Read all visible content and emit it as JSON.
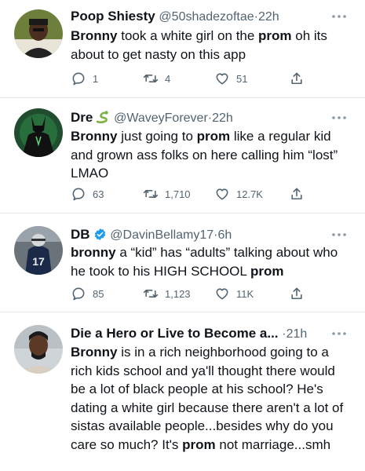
{
  "tweets": [
    {
      "name": "Poop Shiesty",
      "handle": "@50shadezoftae",
      "separator": "·",
      "time": "22h",
      "text": [
        {
          "t": "Bronny",
          "b": true
        },
        {
          "t": " took a white girl on the ",
          "b": false
        },
        {
          "t": "prom",
          "b": true
        },
        {
          "t": " oh its about to get nasty on this app",
          "b": false
        }
      ],
      "replies": "1",
      "retweets": "4",
      "likes": "51"
    },
    {
      "name": "Dre",
      "name_emoji": "snake-icon",
      "handle": "@WaveyForever",
      "separator": "·",
      "time": "22h",
      "text": [
        {
          "t": "Bronny",
          "b": true
        },
        {
          "t": " just going to ",
          "b": false
        },
        {
          "t": "prom",
          "b": true
        },
        {
          "t": " like a regular kid and grown ass folks on here calling him “lost” LMAO",
          "b": false
        }
      ],
      "replies": "63",
      "retweets": "1,710",
      "likes": "12.7K"
    },
    {
      "name": "DB",
      "verified": true,
      "handle": "@DavinBellamy17",
      "separator": "·",
      "time": "6h",
      "text": [
        {
          "t": "bronny",
          "b": true
        },
        {
          "t": " a “kid” has “adults” talking about who he took to his HIGH SCHOOL ",
          "b": false
        },
        {
          "t": "prom",
          "b": true
        }
      ],
      "replies": "85",
      "retweets": "1,123",
      "likes": "11K"
    },
    {
      "name": "Die a Hero or Live to Become a...",
      "handle": "",
      "separator": "·",
      "time": "21h",
      "text": [
        {
          "t": "Bronny",
          "b": true
        },
        {
          "t": " is in a rich neighborhood going to a rich kids school and ya'll thought there would be a lot of black people at his school? He's dating a white girl because there aren't a lot of sistas available people...besides why do you care so much? It's ",
          "b": false
        },
        {
          "t": "prom",
          "b": true
        },
        {
          "t": " not marriage...smh",
          "b": false
        }
      ]
    }
  ],
  "colors": {
    "text": "#0f1419",
    "secondary": "#536471",
    "verified": "#1d9bf0",
    "divider": "#e6e9eb"
  }
}
